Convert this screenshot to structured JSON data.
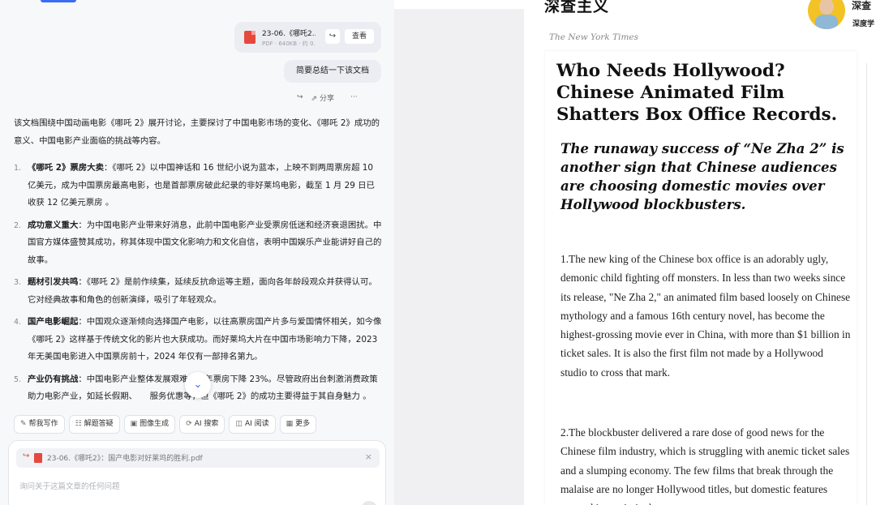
{
  "chat": {
    "file": {
      "name": "23-06.《哪吒2...",
      "meta": "PDF · 640KB · 约 0...",
      "view_label": "查看"
    },
    "user_message": "简要总结一下该文档",
    "actions": {
      "share_label": "分享",
      "more_label": "···"
    },
    "answer": {
      "intro": "该文档围绕中国动画电影《哪吒 2》展开讨论，主要探讨了中国电影市场的变化、《哪吒 2》成功的意义、中国电影产业面临的挑战等内容。",
      "items": [
        {
          "num": "1.",
          "title": "《哪吒 2》票房大卖",
          "text": "：《哪吒 2》以中国神话和 16 世纪小说为蓝本，上映不到两周票房超 10 亿美元，成为中国票房最高电影，也是首部票房破此纪录的非好莱坞电影，截至 1 月 29 日已收获 12 亿美元票房 。"
        },
        {
          "num": "2.",
          "title": "成功意义重大",
          "text": "：为中国电影产业带来好消息，此前中国电影产业受票房低迷和经济衰退困扰。中国官方媒体盛赞其成功，称其体现中国文化影响力和文化自信，表明中国娱乐产业能讲好自己的故事。"
        },
        {
          "num": "3.",
          "title": "题材引发共鸣",
          "text": "：《哪吒 2》是前作续集，延续反抗命运等主题，面向各年龄段观众并获得认可。它对经典故事和角色的创新演绎，吸引了年轻观众。"
        },
        {
          "num": "4.",
          "title": "国产电影崛起",
          "text": "：中国观众逐渐倾向选择国产电影，以往高票房国产片多与爱国情怀相关，如今像《哪吒 2》这样基于传统文化的影片也大获成功。而好莱坞大片在中国市场影响力下降，2023 年无美国电影进入中国票房前十，2024 年仅有一部排名第九。"
        },
        {
          "num": "5.",
          "title": "产业仍有挑战",
          "text": "：中国电影产业整体发展艰难，去年票房下降 23%。尽管政府出台刺激消费政策助力电影产业，如延长假期、　　服务优惠等，但《哪吒 2》的成功主要得益于其自身魅力 。"
        }
      ]
    },
    "tools": [
      {
        "icon": "✎",
        "label": "帮我写作"
      },
      {
        "icon": "☷",
        "label": "解题答疑"
      },
      {
        "icon": "▣",
        "label": "图像生成"
      },
      {
        "icon": "⟳",
        "label": "AI 搜索"
      },
      {
        "icon": "◫",
        "label": "AI 阅读"
      },
      {
        "icon": "▦",
        "label": "更多"
      }
    ],
    "attachment": {
      "name": "23-06.《哪吒2》：国产电影对好莱坞的胜利.pdf"
    },
    "input": {
      "placeholder": "询问关于这篇文章的任何问题"
    }
  },
  "article": {
    "cn_title": "深查主义",
    "author_name": "深查",
    "author_sub": "深度学",
    "source": "The New York Times",
    "headline": "Who Needs Hollywood? Chinese Animated Film Shatters Box Office Records.",
    "subhead": "The runaway success of “Ne Zha 2” is another sign that Chinese audiences are choosing domestic movies over Hollywood blockbusters.",
    "para1": "1.The new king of the Chinese box office is an adorably ugly, demonic child fighting off monsters. In less than two weeks since its release, \"Ne Zha 2,\" an animated film based loosely on Chinese mythology and a famous 16th century novel, has become the highest-grossing movie ever in China, with more than $1 billion in ticket sales. It is also the first film not made by a Hollywood studio to cross that mark.",
    "para2": "2.The blockbuster delivered a rare dose of good news for the Chinese film industry, which is struggling with anemic ticket sales and a slumping economy. The few films that break through the malaise are no longer Hollywood titles, but domestic features steeped in patriotic themes or"
  },
  "colors": {
    "accent": "#3b6cf5",
    "pdf_red": "#e5483d",
    "bubble": "#ebedf2"
  }
}
